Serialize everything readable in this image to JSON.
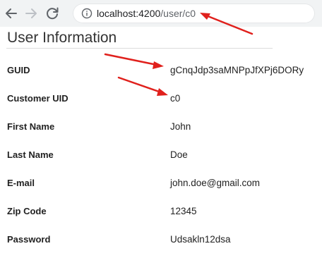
{
  "browser": {
    "url_host": "localhost:4200",
    "url_path": "/user/c0"
  },
  "page": {
    "title": "User Information",
    "fields": [
      {
        "label": "GUID",
        "value": "gCnqJdp3saMNPpJfXPj6DORy"
      },
      {
        "label": "Customer UID",
        "value": "c0"
      },
      {
        "label": "First Name",
        "value": "John"
      },
      {
        "label": "Last Name",
        "value": "Doe"
      },
      {
        "label": "E-mail",
        "value": "john.doe@gmail.com"
      },
      {
        "label": "Zip Code",
        "value": "12345"
      },
      {
        "label": "Password",
        "value": "Udsakln12dsa"
      }
    ]
  },
  "annotations": {
    "arrow_color": "#e0201c"
  }
}
